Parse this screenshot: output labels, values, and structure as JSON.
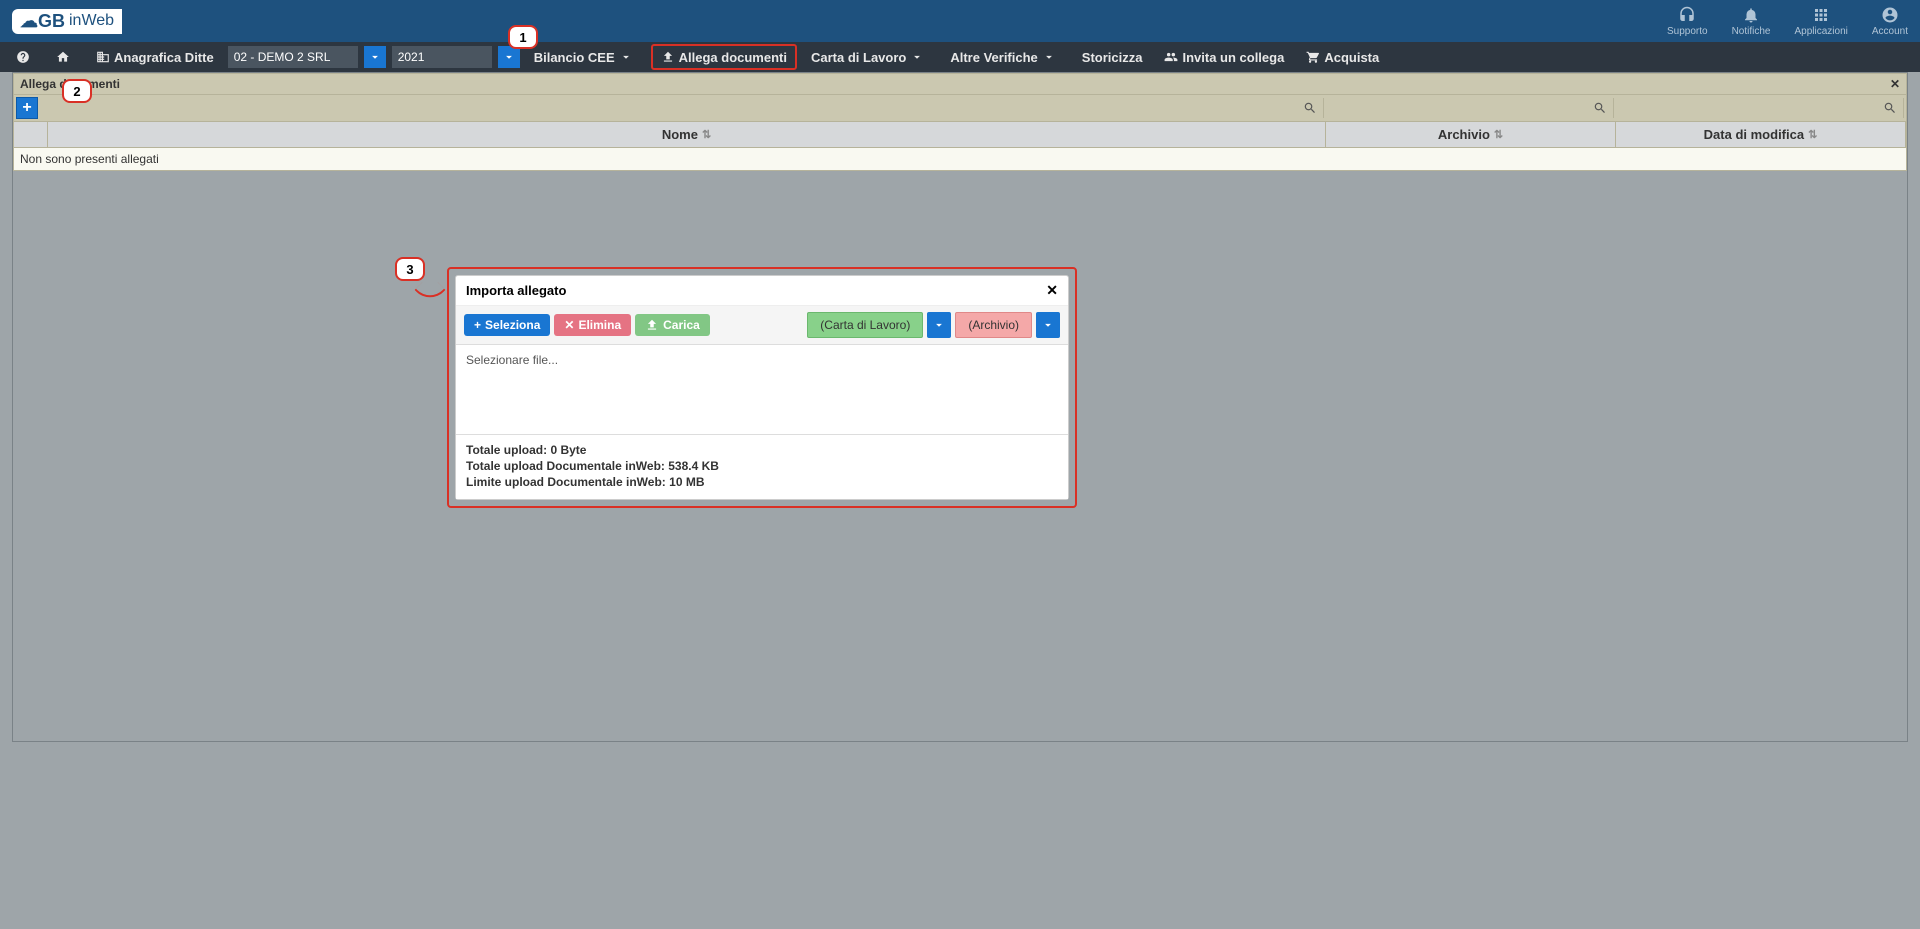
{
  "brand": "inWeb",
  "topIcons": {
    "support": "Supporto",
    "notifications": "Notifiche",
    "apps": "Applicazioni",
    "account": "Account"
  },
  "menu": {
    "anagrafica": "Anagrafica Ditte",
    "companySelect": "02 - DEMO 2 SRL",
    "yearSelect": "2021",
    "bilancio": "Bilancio CEE",
    "allegaDocumenti": "Allega documenti",
    "cartaLavoro": "Carta di Lavoro",
    "altreVerifiche": "Altre Verifiche",
    "storicizza": "Storicizza",
    "invitaCollega": "Invita un collega",
    "acquista": "Acquista"
  },
  "panel": {
    "title": "Allega documenti",
    "columns": {
      "nome": "Nome",
      "archivio": "Archivio",
      "dataModifica": "Data di modifica"
    },
    "emptyMessage": "Non sono presenti allegati"
  },
  "callouts": {
    "c1": "1",
    "c2": "2",
    "c3": "3"
  },
  "modal": {
    "title": "Importa allegato",
    "seleziona": "Seleziona",
    "elimina": "Elimina",
    "carica": "Carica",
    "tagCarta": "(Carta di Lavoro)",
    "tagArchivio": "(Archivio)",
    "placeholder": "Selezionare file...",
    "totalUploadLabel": "Totale upload:",
    "totalUploadValue": "0 Byte",
    "totalDocLabel": "Totale upload Documentale inWeb:",
    "totalDocValue": "538.4 KB",
    "limitLabel": "Limite upload Documentale inWeb:",
    "limitValue": "10 MB"
  }
}
